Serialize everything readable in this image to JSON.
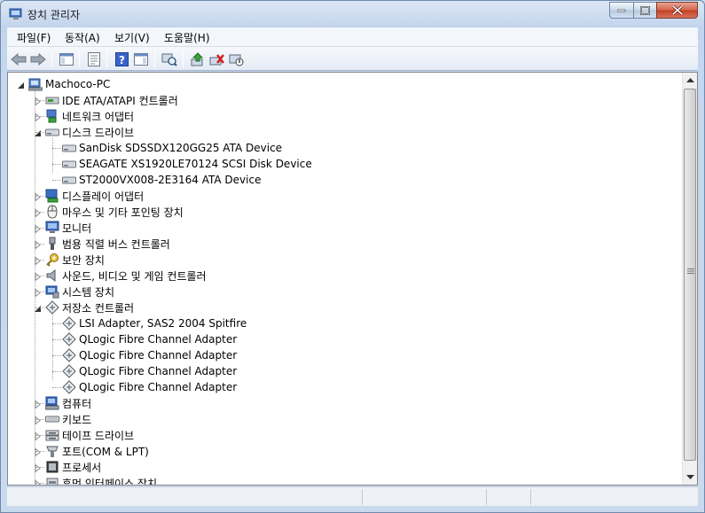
{
  "window": {
    "title": "장치 관리자",
    "accent": "#c9d9ee"
  },
  "menu": {
    "items": [
      "파일(F)",
      "동작(A)",
      "보기(V)",
      "도움말(H)"
    ]
  },
  "toolbar": {
    "buttons": [
      "back-arrow-icon",
      "forward-arrow-icon",
      "show-hide-console-tree-icon",
      "properties-icon",
      "help-icon",
      "action-pane-icon",
      "scan-hardware-icon",
      "update-driver-icon",
      "uninstall-device-icon",
      "disable-device-icon"
    ]
  },
  "tree": {
    "root": "Machoco-PC",
    "nodes": [
      {
        "label": "IDE ATA/ATAPI 컨트롤러",
        "expanded": false,
        "icon": "ide-controller-icon"
      },
      {
        "label": "네트워크 어댑터",
        "expanded": false,
        "icon": "network-adapter-icon"
      },
      {
        "label": "디스크 드라이브",
        "expanded": true,
        "icon": "disk-drive-icon",
        "children": [
          "SanDisk SDSSDX120GG25 ATA Device",
          "SEAGATE XS1920LE70124 SCSI Disk Device",
          "ST2000VX008-2E3164 ATA Device"
        ]
      },
      {
        "label": "디스플레이 어댑터",
        "expanded": false,
        "icon": "display-adapter-icon"
      },
      {
        "label": "마우스 및 기타 포인팅 장치",
        "expanded": false,
        "icon": "mouse-icon"
      },
      {
        "label": "모니터",
        "expanded": false,
        "icon": "monitor-icon"
      },
      {
        "label": "범용 직렬 버스 컨트롤러",
        "expanded": false,
        "icon": "usb-controller-icon"
      },
      {
        "label": "보안 장치",
        "expanded": false,
        "icon": "security-key-icon"
      },
      {
        "label": "사운드, 비디오 및 게임 컨트롤러",
        "expanded": false,
        "icon": "speaker-icon"
      },
      {
        "label": "시스템 장치",
        "expanded": false,
        "icon": "system-device-icon"
      },
      {
        "label": "저장소 컨트롤러",
        "expanded": true,
        "icon": "storage-controller-icon",
        "children": [
          "LSI Adapter, SAS2 2004 Spitfire",
          "QLogic Fibre Channel Adapter",
          "QLogic Fibre Channel Adapter",
          "QLogic Fibre Channel Adapter",
          "QLogic Fibre Channel Adapter"
        ]
      },
      {
        "label": "컴퓨터",
        "expanded": false,
        "icon": "computer-icon"
      },
      {
        "label": "키보드",
        "expanded": false,
        "icon": "keyboard-icon"
      },
      {
        "label": "테이프 드라이브",
        "expanded": false,
        "icon": "tape-drive-icon"
      },
      {
        "label": "포트(COM & LPT)",
        "expanded": false,
        "icon": "port-icon"
      },
      {
        "label": "프로세서",
        "expanded": false,
        "icon": "processor-icon"
      },
      {
        "label": "휴먼 인터페이스 장치",
        "expanded": false,
        "icon": "hid-icon"
      }
    ]
  }
}
